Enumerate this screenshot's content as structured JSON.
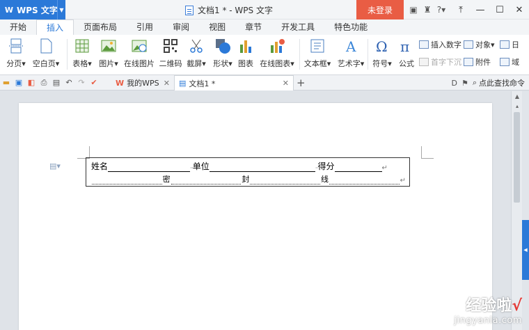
{
  "app": {
    "name": "WPS 文字",
    "logo": "W"
  },
  "window": {
    "title": "文档1 * - WPS 文字",
    "login": "未登录"
  },
  "menu": [
    "开始",
    "插入",
    "页面布局",
    "引用",
    "审阅",
    "视图",
    "章节",
    "开发工具",
    "特色功能"
  ],
  "active_menu": "插入",
  "ribbon": {
    "break": "分页",
    "blank_page": "空白页",
    "table": "表格",
    "picture": "图片",
    "online_picture": "在线图片",
    "qrcode": "二维码",
    "screenshot": "截屏",
    "shape": "形状",
    "chart": "图表",
    "online_chart": "在线图表",
    "textbox": "文本框",
    "wordart": "艺术字",
    "symbol": "符号",
    "formula": "公式",
    "insert_number": "插入数字",
    "drop_cap": "首字下沉",
    "object": "对象",
    "attachment": "附件",
    "date": "日",
    "field": "域"
  },
  "tabs": {
    "home": "我的WPS",
    "doc": "文档1 *"
  },
  "search_cmd": "点此查找命令",
  "document": {
    "row1": {
      "name_label": "姓名",
      "unit_label": "单位",
      "score_label": "得分"
    },
    "row2": {
      "mi": "密",
      "feng": "封",
      "xian": "线"
    }
  },
  "watermark": {
    "line1": "经验啦",
    "check": "√",
    "line2": "jingyanla.com"
  }
}
